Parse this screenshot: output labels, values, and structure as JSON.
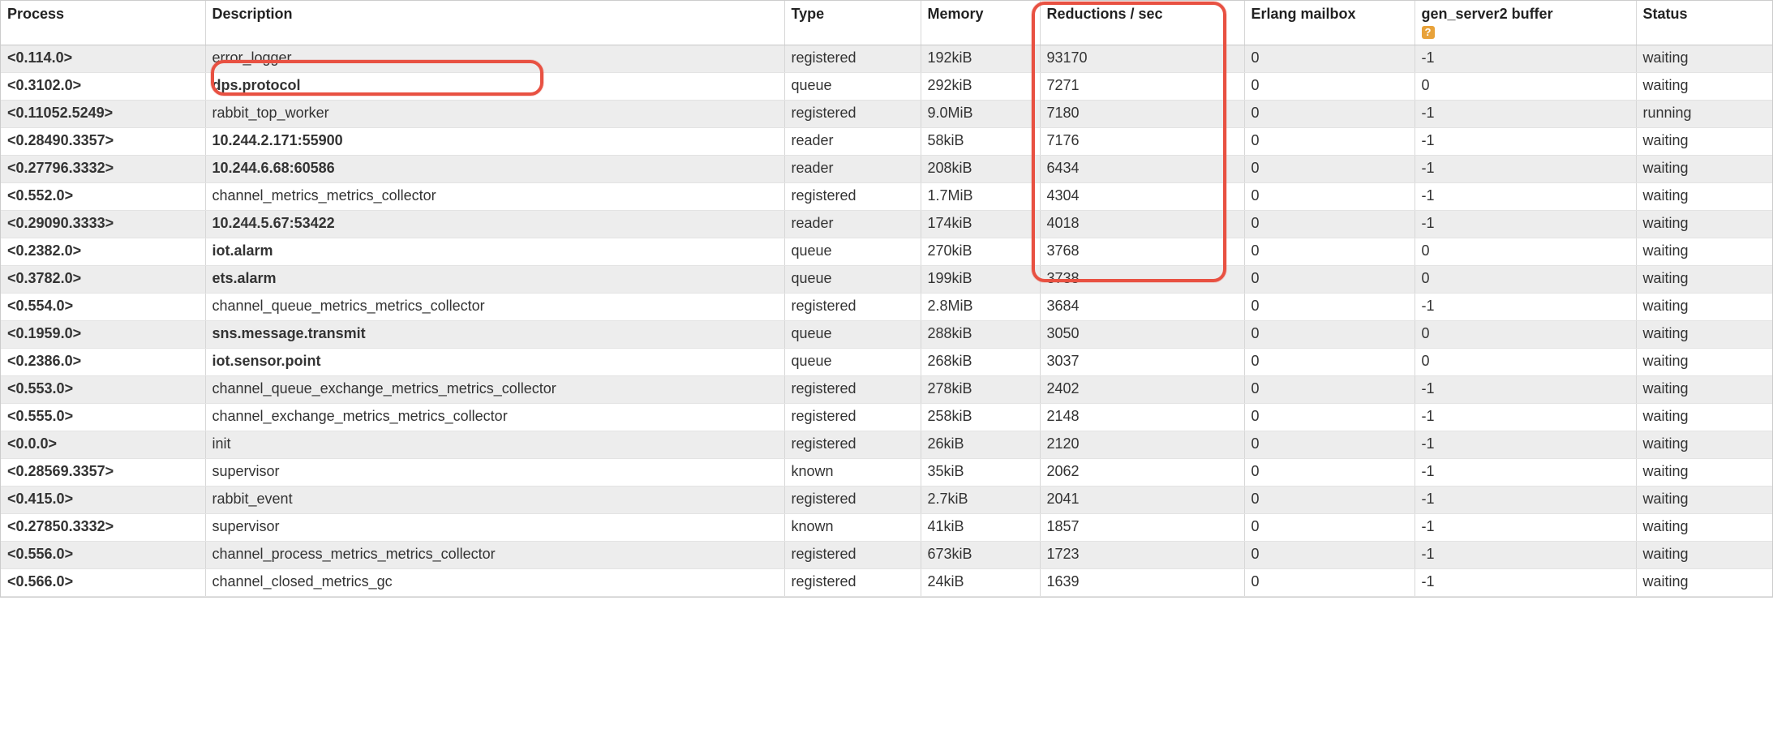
{
  "columns": {
    "process": "Process",
    "description": "Description",
    "type": "Type",
    "memory": "Memory",
    "reductions": "Reductions / sec",
    "mailbox": "Erlang mailbox",
    "buffer": "gen_server2 buffer",
    "status": "Status"
  },
  "help_symbol": "?",
  "rows": [
    {
      "process": "<0.114.0>",
      "desc": "error_logger",
      "desc_bold": false,
      "type": "registered",
      "memory": "192kiB",
      "reductions": "93170",
      "mailbox": "0",
      "buffer": "-1",
      "status": "waiting"
    },
    {
      "process": "<0.3102.0>",
      "desc": "dps.protocol",
      "desc_bold": true,
      "type": "queue",
      "memory": "292kiB",
      "reductions": "7271",
      "mailbox": "0",
      "buffer": "0",
      "status": "waiting"
    },
    {
      "process": "<0.11052.5249>",
      "desc": "rabbit_top_worker",
      "desc_bold": false,
      "type": "registered",
      "memory": "9.0MiB",
      "reductions": "7180",
      "mailbox": "0",
      "buffer": "-1",
      "status": "running"
    },
    {
      "process": "<0.28490.3357>",
      "desc": "10.244.2.171:55900",
      "desc_bold": true,
      "type": "reader",
      "memory": "58kiB",
      "reductions": "7176",
      "mailbox": "0",
      "buffer": "-1",
      "status": "waiting"
    },
    {
      "process": "<0.27796.3332>",
      "desc": "10.244.6.68:60586",
      "desc_bold": true,
      "type": "reader",
      "memory": "208kiB",
      "reductions": "6434",
      "mailbox": "0",
      "buffer": "-1",
      "status": "waiting"
    },
    {
      "process": "<0.552.0>",
      "desc": "channel_metrics_metrics_collector",
      "desc_bold": false,
      "type": "registered",
      "memory": "1.7MiB",
      "reductions": "4304",
      "mailbox": "0",
      "buffer": "-1",
      "status": "waiting"
    },
    {
      "process": "<0.29090.3333>",
      "desc": "10.244.5.67:53422",
      "desc_bold": true,
      "type": "reader",
      "memory": "174kiB",
      "reductions": "4018",
      "mailbox": "0",
      "buffer": "-1",
      "status": "waiting"
    },
    {
      "process": "<0.2382.0>",
      "desc": "iot.alarm",
      "desc_bold": true,
      "type": "queue",
      "memory": "270kiB",
      "reductions": "3768",
      "mailbox": "0",
      "buffer": "0",
      "status": "waiting"
    },
    {
      "process": "<0.3782.0>",
      "desc": "ets.alarm",
      "desc_bold": true,
      "type": "queue",
      "memory": "199kiB",
      "reductions": "3738",
      "mailbox": "0",
      "buffer": "0",
      "status": "waiting"
    },
    {
      "process": "<0.554.0>",
      "desc": "channel_queue_metrics_metrics_collector",
      "desc_bold": false,
      "type": "registered",
      "memory": "2.8MiB",
      "reductions": "3684",
      "mailbox": "0",
      "buffer": "-1",
      "status": "waiting"
    },
    {
      "process": "<0.1959.0>",
      "desc": "sns.message.transmit",
      "desc_bold": true,
      "type": "queue",
      "memory": "288kiB",
      "reductions": "3050",
      "mailbox": "0",
      "buffer": "0",
      "status": "waiting"
    },
    {
      "process": "<0.2386.0>",
      "desc": "iot.sensor.point",
      "desc_bold": true,
      "type": "queue",
      "memory": "268kiB",
      "reductions": "3037",
      "mailbox": "0",
      "buffer": "0",
      "status": "waiting"
    },
    {
      "process": "<0.553.0>",
      "desc": "channel_queue_exchange_metrics_metrics_collector",
      "desc_bold": false,
      "type": "registered",
      "memory": "278kiB",
      "reductions": "2402",
      "mailbox": "0",
      "buffer": "-1",
      "status": "waiting"
    },
    {
      "process": "<0.555.0>",
      "desc": "channel_exchange_metrics_metrics_collector",
      "desc_bold": false,
      "type": "registered",
      "memory": "258kiB",
      "reductions": "2148",
      "mailbox": "0",
      "buffer": "-1",
      "status": "waiting"
    },
    {
      "process": "<0.0.0>",
      "desc": "init",
      "desc_bold": false,
      "type": "registered",
      "memory": "26kiB",
      "reductions": "2120",
      "mailbox": "0",
      "buffer": "-1",
      "status": "waiting"
    },
    {
      "process": "<0.28569.3357>",
      "desc": "supervisor",
      "desc_bold": false,
      "type": "known",
      "memory": "35kiB",
      "reductions": "2062",
      "mailbox": "0",
      "buffer": "-1",
      "status": "waiting"
    },
    {
      "process": "<0.415.0>",
      "desc": "rabbit_event",
      "desc_bold": false,
      "type": "registered",
      "memory": "2.7kiB",
      "reductions": "2041",
      "mailbox": "0",
      "buffer": "-1",
      "status": "waiting"
    },
    {
      "process": "<0.27850.3332>",
      "desc": "supervisor",
      "desc_bold": false,
      "type": "known",
      "memory": "41kiB",
      "reductions": "1857",
      "mailbox": "0",
      "buffer": "-1",
      "status": "waiting"
    },
    {
      "process": "<0.556.0>",
      "desc": "channel_process_metrics_metrics_collector",
      "desc_bold": false,
      "type": "registered",
      "memory": "673kiB",
      "reductions": "1723",
      "mailbox": "0",
      "buffer": "-1",
      "status": "waiting"
    },
    {
      "process": "<0.566.0>",
      "desc": "channel_closed_metrics_gc",
      "desc_bold": false,
      "type": "registered",
      "memory": "24kiB",
      "reductions": "1639",
      "mailbox": "0",
      "buffer": "-1",
      "status": "waiting"
    }
  ]
}
